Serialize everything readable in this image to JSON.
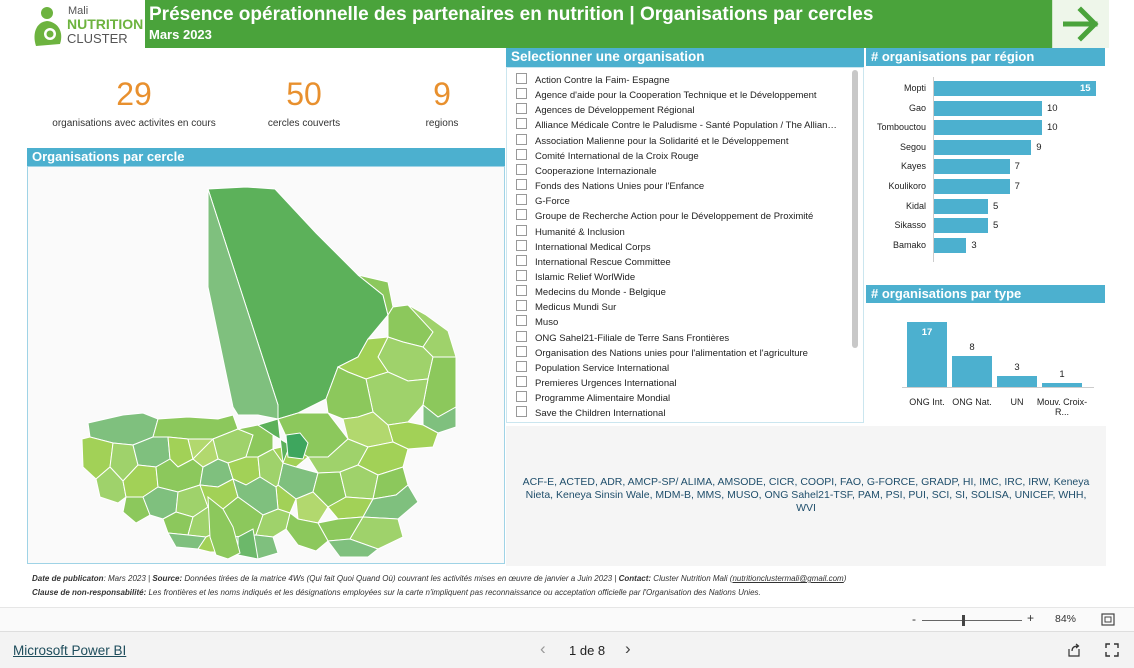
{
  "header": {
    "logo_line1": "Mali",
    "logo_line2": "NUTRITION",
    "logo_line3": "CLUSTER",
    "title": "Présence opérationnelle des partenaires en nutrition | Organisations par cercles",
    "subtitle": "Mars 2023"
  },
  "kpis": [
    {
      "value": "29",
      "label": "organisations avec activites en cours"
    },
    {
      "value": "50",
      "label": "cercles couverts"
    },
    {
      "value": "9",
      "label": "regions"
    }
  ],
  "map": {
    "title": "Organisations par cercle"
  },
  "orglist": {
    "title": "Selectionner une organisation",
    "items": [
      "Action Contre la Faim- Espagne",
      "Agence d'aide pour la Cooperation Technique et le Développement",
      "Agences de Développement Régional",
      "Alliance Médicale Contre le Paludisme - Santé Population / The Allian…",
      "Association Malienne pour la Solidarité et le Développement",
      "Comité International de la Croix Rouge",
      "Cooperazione Internazionale",
      "Fonds des Nations Unies pour l'Enfance",
      "G-Force",
      "Groupe de Recherche Action pour le Développement de Proximité",
      "Humanité & Inclusion",
      "International Medical Corps",
      "International Rescue Committee",
      "Islamic Relief WorlWide",
      "Medecins du Monde - Belgique",
      "Medicus Mundi Sur",
      "Muso",
      "ONG Sahel21-Filiale de Terre Sans Frontières",
      "Organisation des Nations unies pour l'alimentation et l'agriculture",
      "Population Service International",
      "Premieres Urgences International",
      "Programme Alimentaire Mondial",
      "Save the Children International"
    ]
  },
  "region_chart": {
    "title": "# organisations par région",
    "chart_data": {
      "type": "bar",
      "categories": [
        "Mopti",
        "Gao",
        "Tombouctou",
        "Segou",
        "Kayes",
        "Koulikoro",
        "Kidal",
        "Sikasso",
        "Bamako"
      ],
      "values": [
        15,
        10,
        10,
        9,
        7,
        7,
        5,
        5,
        3
      ],
      "labels": [
        "15",
        "10",
        "10",
        "9",
        "7",
        "7",
        "5",
        "5",
        "3"
      ]
    }
  },
  "type_chart": {
    "title": "# organisations par type",
    "chart_data": {
      "type": "bar",
      "categories": [
        "ONG Int.",
        "ONG Nat.",
        "UN",
        "Mouv. Croix-R..."
      ],
      "values": [
        17,
        8,
        3,
        1
      ],
      "labels": [
        "17",
        "8",
        "3",
        "1"
      ]
    }
  },
  "acronyms": "ACF-E, ACTED, ADR, AMCP-SP/ ALIMA, AMSODE, CICR, COOPI, FAO, G-FORCE, GRADP, HI, IMC, IRC, IRW, Keneya Nieta, Keneya Sinsin Wale, MDM-B, MMS, MUSO, ONG Sahel21-TSF, PAM, PSI, PUI, SCI, SI, SOLISA, UNICEF, WHH, WVI",
  "footer": {
    "pub_label": "Date de publicaton",
    "pub_value": ": Mars 2023 | ",
    "source_label": "Source:",
    "source_value": " Données tirées de la matrice 4Ws (Qui fait Quoi Quand Où) couvrant les activités mises en œuvre de janvier a Juin 2023 | ",
    "contact_label": "Contact:",
    "contact_value": " Cluster Nutrition Mali (",
    "email": "nutritionclustermali@gmail.com",
    "contact_end": ")",
    "disclaimer_label": "Clause de non-responsabilité:",
    "disclaimer_value": " Les frontières et les noms indiqués et les désignations employées sur la carte n'impliquent pas reconnaissance ou acceptation officielle par l'Organisation des Nations Unies."
  },
  "zoom": {
    "minus": "-",
    "plus": "+",
    "level": "84%"
  },
  "powerbi": {
    "brand": "Microsoft Power BI",
    "page": "1 de 8",
    "prev": "‹",
    "next": "›"
  },
  "colors": {
    "header_green": "#4aa33b",
    "accent_blue": "#4cb0cf",
    "kpi_orange": "#e8902e"
  }
}
